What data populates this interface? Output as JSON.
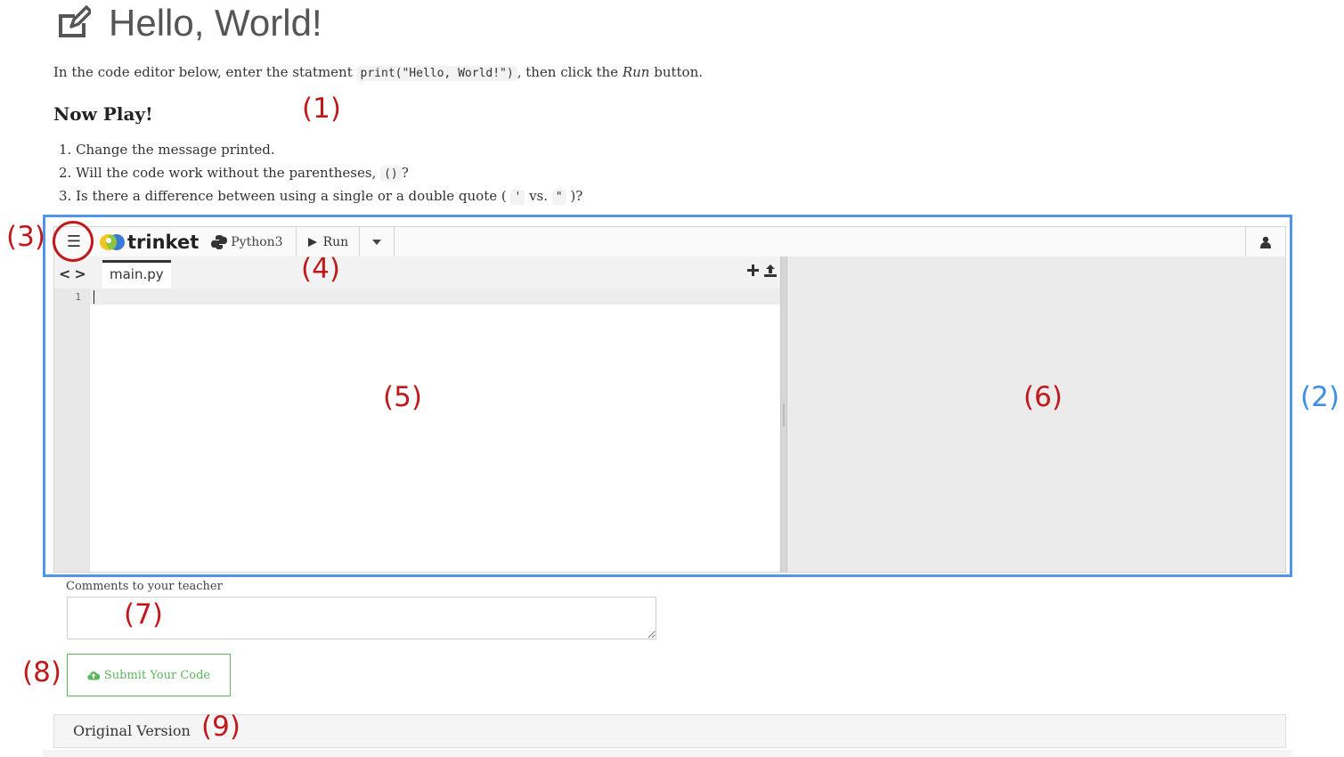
{
  "page": {
    "title": "Hello, World!",
    "intro_before": "In the code editor below, enter the statment ",
    "intro_code": "print(\"Hello, World!\")",
    "intro_middle": ", then click the ",
    "intro_run": "Run",
    "intro_after": " button.",
    "heading": "Now Play!"
  },
  "steps": {
    "s1": "1. Change the message printed.",
    "s2_before": "2. Will the code work without the parentheses, ",
    "s2_code": "()",
    "s2_after": "?",
    "s3_before": "3. Is there a difference between using a single or a double quote ( ",
    "s3_code1": "'",
    "s3_mid": " vs. ",
    "s3_code2": "\"",
    "s3_after": " )?"
  },
  "annotations": {
    "a1": "(1)",
    "a2": "(2)",
    "a3": "(3)",
    "a4": "(4)",
    "a5": "(5)",
    "a6": "(6)",
    "a7": "(7)",
    "a8": "(8)",
    "a9": "(9)"
  },
  "editor": {
    "brand": "trinket",
    "language": "Python3",
    "run_label": "Run",
    "file_tab": "main.py",
    "nav_arrows": "<>",
    "line_number": "1",
    "code": ""
  },
  "comments": {
    "label": "Comments to your teacher",
    "value": ""
  },
  "submit": {
    "label": "Submit Your Code"
  },
  "original": {
    "label": "Original Version"
  },
  "colors": {
    "annotation_red": "#c0191b",
    "annotation_blue": "#3d8fe6",
    "submit_green": "#5cb85c"
  }
}
